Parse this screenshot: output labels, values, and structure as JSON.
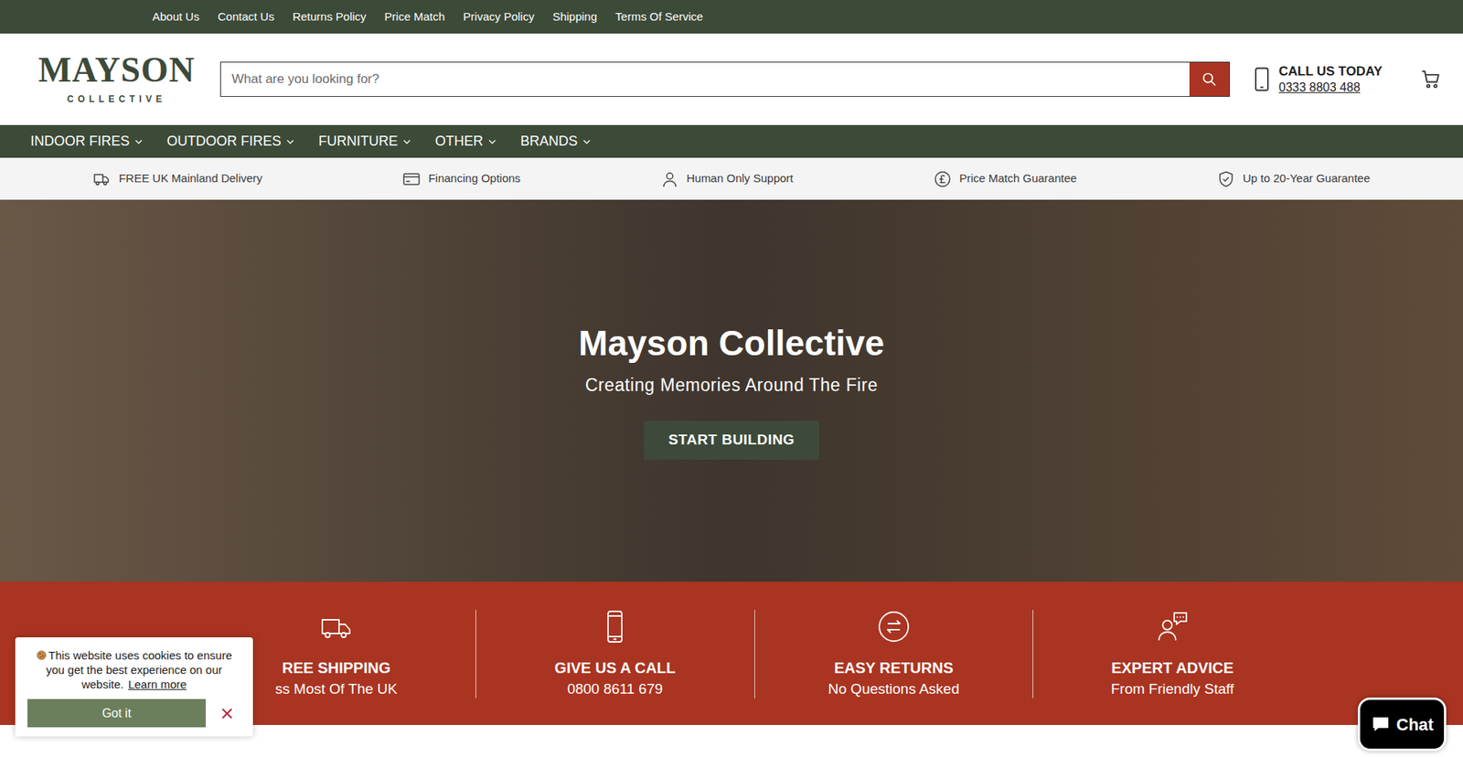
{
  "top_links": [
    "About Us",
    "Contact Us",
    "Returns Policy",
    "Price Match",
    "Privacy Policy",
    "Shipping",
    "Terms Of Service"
  ],
  "logo": {
    "name": "MAYSON",
    "tagline": "COLLECTIVE"
  },
  "search": {
    "placeholder": "What are you looking for?"
  },
  "call": {
    "label": "CALL US TODAY",
    "phone": "0333 8803 488"
  },
  "nav": [
    "INDOOR FIRES",
    "OUTDOOR FIRES",
    "FURNITURE",
    "OTHER",
    "BRANDS"
  ],
  "usps": [
    "FREE UK Mainland Delivery",
    "Financing Options",
    "Human Only Support",
    "Price Match Guarantee",
    "Up to 20-Year Guarantee"
  ],
  "hero": {
    "title": "Mayson Collective",
    "subtitle": "Creating Memories Around The Fire",
    "button": "START BUILDING"
  },
  "features": [
    {
      "title": "REE SHIPPING",
      "subtitle": "ss Most Of The UK"
    },
    {
      "title": "GIVE US A CALL",
      "subtitle": "0800 8611 679"
    },
    {
      "title": "EASY RETURNS",
      "subtitle": "No Questions Asked"
    },
    {
      "title": "EXPERT ADVICE",
      "subtitle": "From Friendly Staff"
    }
  ],
  "cookie": {
    "message": "This website uses cookies to ensure you get the best experience on our website.",
    "link": "Learn more",
    "accept": "Got it"
  },
  "chat": {
    "label": "Chat"
  }
}
